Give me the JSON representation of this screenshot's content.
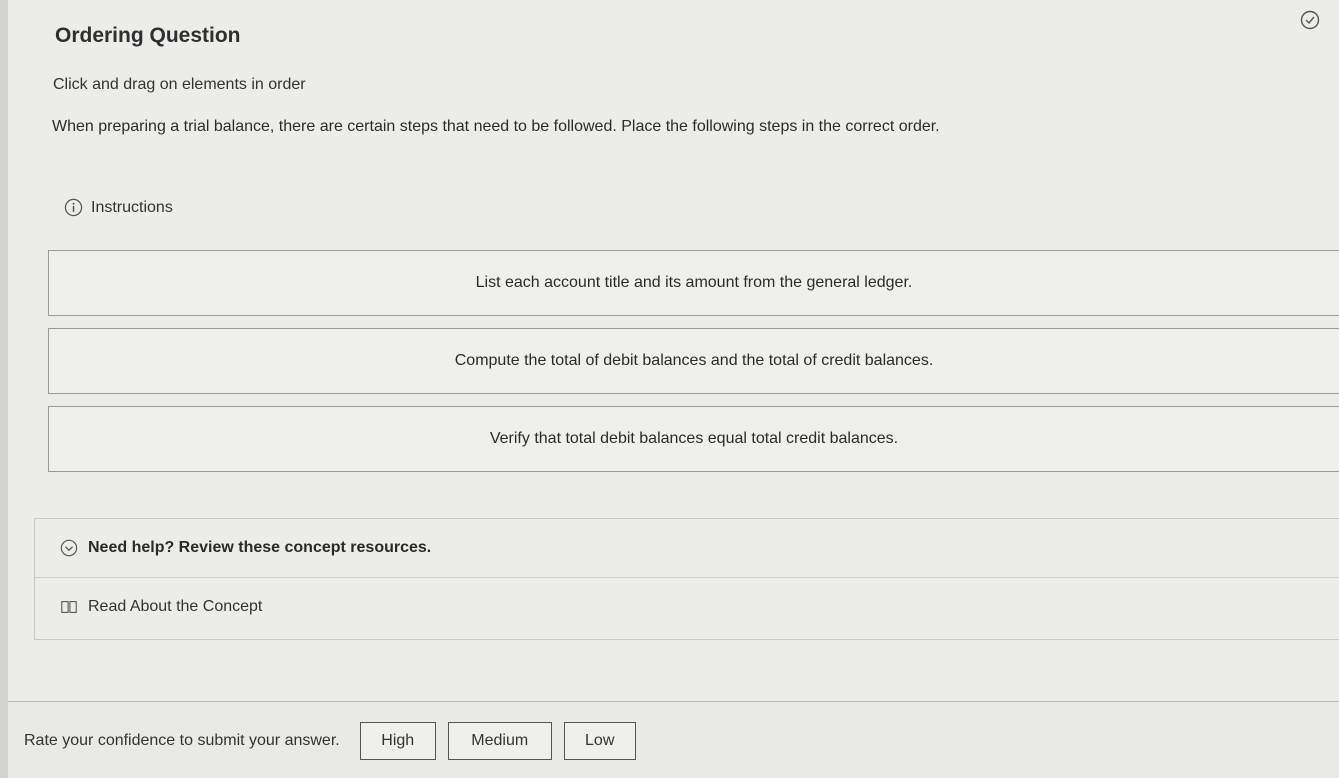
{
  "header": {
    "title": "Ordering Question",
    "subtitle": "Click and drag on elements in order",
    "prompt": "When preparing a trial balance, there are certain steps that need to be followed. Place the following steps in the correct order."
  },
  "instructions": {
    "label": "Instructions",
    "icon": "info-icon"
  },
  "order_items": [
    "List each account title and its amount from the general ledger.",
    "Compute the total of debit balances and the total of credit balances.",
    "Verify that total debit balances equal total credit balances."
  ],
  "help": {
    "toggle_label": "Need help? Review these concept resources.",
    "concept_link": "Read About the Concept"
  },
  "footer": {
    "rate_text": "Rate your confidence to submit your answer.",
    "buttons": [
      "High",
      "Medium",
      "Low"
    ]
  },
  "colors": {
    "background": "#ececea",
    "border": "#9b9b99",
    "text": "#2b2b2b"
  }
}
